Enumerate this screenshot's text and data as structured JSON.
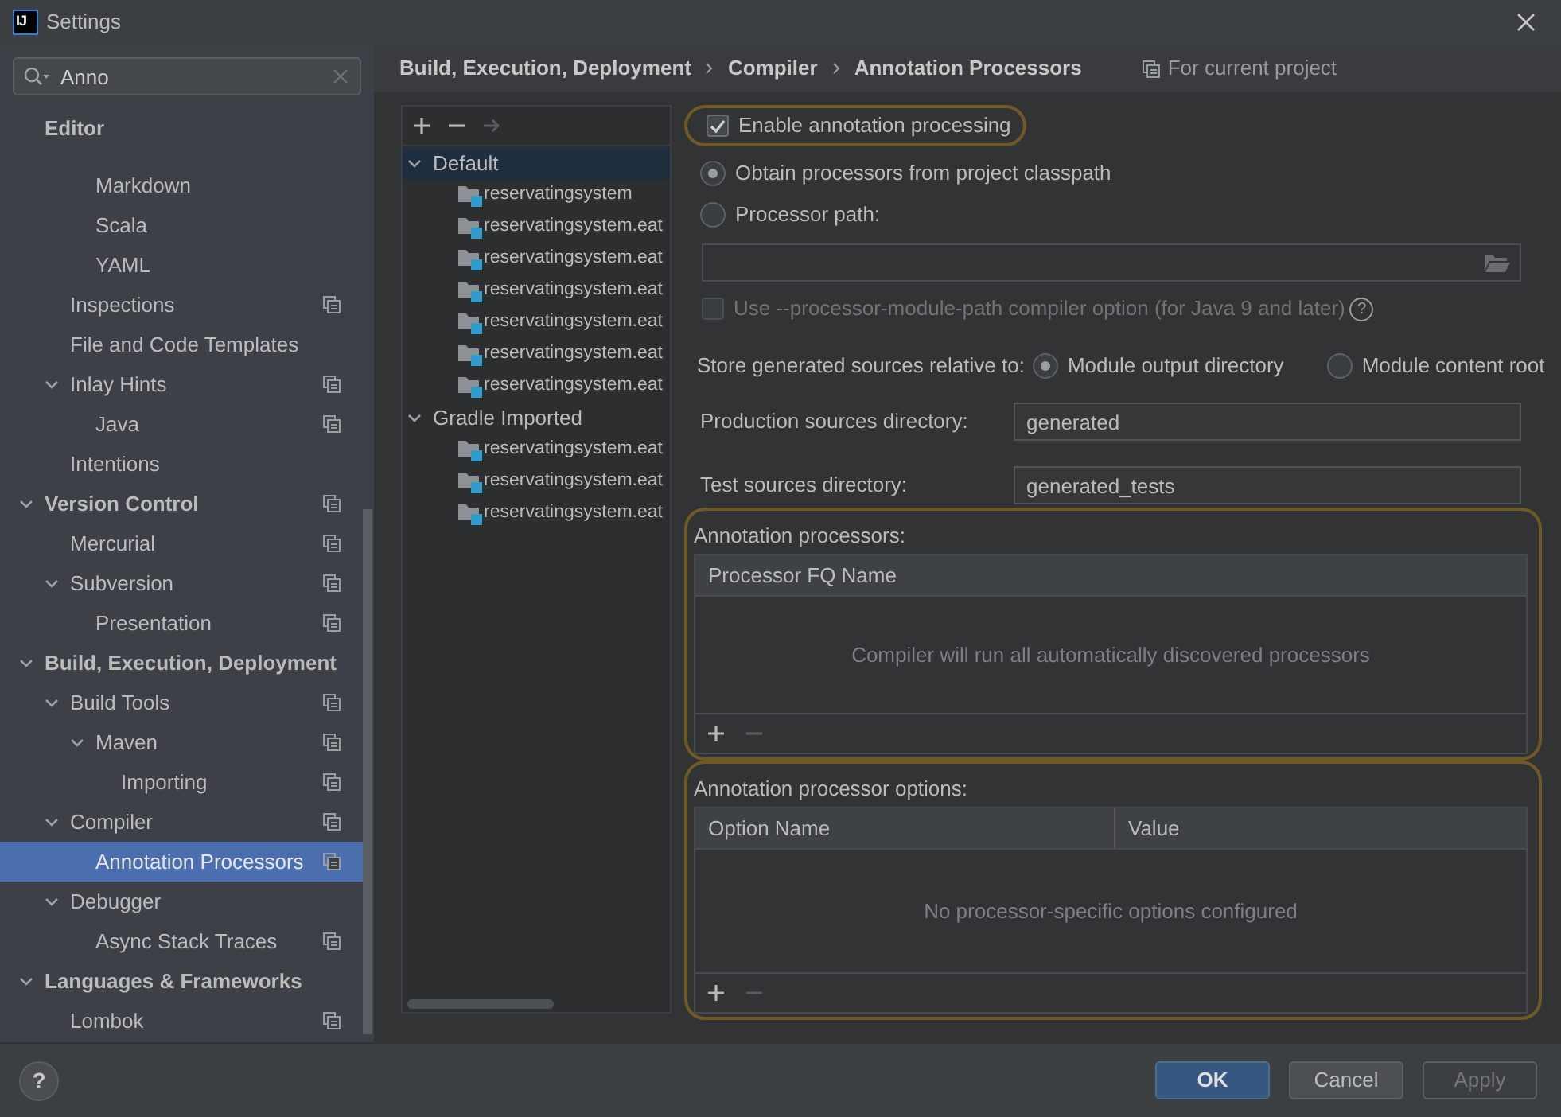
{
  "window": {
    "logo": "IJ",
    "title": "Settings"
  },
  "search": {
    "value": "Anno"
  },
  "sidebar": {
    "items": [
      {
        "label": "Editor",
        "sticky": true,
        "selected": false,
        "project_scope": false,
        "children": [
          {
            "children": [
              {
                "label": "Markdown",
                "selected": false,
                "project_scope": false
              },
              {
                "label": "Scala",
                "selected": false,
                "project_scope": false
              },
              {
                "label": "YAML",
                "selected": false,
                "project_scope": false
              }
            ]
          },
          {
            "label": "Inspections",
            "selected": false,
            "project_scope": true
          },
          {
            "label": "File and Code Templates",
            "selected": false,
            "project_scope": false
          },
          {
            "label": "Inlay Hints",
            "expanded": true,
            "selected": false,
            "project_scope": true,
            "children": [
              {
                "label": "Java",
                "selected": false,
                "project_scope": true
              }
            ]
          },
          {
            "label": "Intentions",
            "selected": false,
            "project_scope": false
          }
        ]
      },
      {
        "label": "Version Control",
        "expanded": true,
        "selected": false,
        "project_scope": true,
        "children": [
          {
            "label": "Mercurial",
            "selected": false,
            "project_scope": true
          },
          {
            "label": "Subversion",
            "expanded": true,
            "selected": false,
            "project_scope": true,
            "children": [
              {
                "label": "Presentation",
                "selected": false,
                "project_scope": true
              }
            ]
          }
        ]
      },
      {
        "label": "Build, Execution, Deployment",
        "expanded": true,
        "selected": false,
        "project_scope": false,
        "children": [
          {
            "label": "Build Tools",
            "expanded": true,
            "selected": false,
            "project_scope": true,
            "children": [
              {
                "label": "Maven",
                "expanded": true,
                "selected": false,
                "project_scope": true,
                "children": [
                  {
                    "label": "Importing",
                    "selected": false,
                    "project_scope": true
                  }
                ]
              }
            ]
          },
          {
            "label": "Compiler",
            "expanded": true,
            "selected": false,
            "project_scope": true,
            "children": [
              {
                "label": "Annotation Processors",
                "selected": true,
                "project_scope": true
              }
            ]
          },
          {
            "label": "Debugger",
            "expanded": true,
            "selected": false,
            "project_scope": false,
            "children": [
              {
                "label": "Async Stack Traces",
                "selected": false,
                "project_scope": true
              }
            ]
          }
        ]
      },
      {
        "label": "Languages & Frameworks",
        "expanded": true,
        "selected": false,
        "project_scope": false,
        "children": [
          {
            "label": "Lombok",
            "selected": false,
            "project_scope": true
          }
        ]
      }
    ]
  },
  "breadcrumb": {
    "items": [
      "Build, Execution, Deployment",
      "Compiler",
      "Annotation Processors"
    ],
    "scope": "For current project"
  },
  "profiles": {
    "toolbar": [
      {
        "kind": "add",
        "disabled": false
      },
      {
        "kind": "remove",
        "disabled": false
      },
      {
        "kind": "move",
        "disabled": true
      }
    ],
    "items": [
      {
        "label": "Default",
        "expanded": true,
        "selected": true,
        "children": [
          {
            "label": "reservatingsystem"
          },
          {
            "label": "reservatingsystem.eat"
          },
          {
            "label": "reservatingsystem.eat"
          },
          {
            "label": "reservatingsystem.eat"
          },
          {
            "label": "reservatingsystem.eat"
          },
          {
            "label": "reservatingsystem.eat"
          },
          {
            "label": "reservatingsystem.eat"
          }
        ]
      },
      {
        "label": "Gradle Imported",
        "expanded": true,
        "selected": false,
        "children": [
          {
            "label": "reservatingsystem.eat"
          },
          {
            "label": "reservatingsystem.eat"
          },
          {
            "label": "reservatingsystem.eat"
          }
        ]
      }
    ]
  },
  "form": {
    "enable": {
      "label": "Enable annotation processing",
      "checked": true,
      "highlighted": true
    },
    "source": [
      {
        "label": "Obtain processors from project classpath",
        "selected": true
      },
      {
        "label": "Processor path:",
        "selected": false
      }
    ],
    "processor_path": {
      "disabled": true
    },
    "module_path": {
      "label": "Use --processor-module-path compiler option (for Java 9 and later)",
      "checked": false,
      "disabled": true,
      "help": "?"
    },
    "store": {
      "label": "Store generated sources relative to:",
      "options": [
        {
          "label": "Module output directory",
          "selected": true
        },
        {
          "label": "Module content root",
          "selected": false
        }
      ]
    },
    "production": {
      "label": "Production sources directory:",
      "value": "generated"
    },
    "test": {
      "label": "Test sources directory:",
      "value": "generated_tests"
    },
    "sections": [
      {
        "title": "Annotation processors:",
        "highlighted": true,
        "columns": [
          "Processor FQ Name"
        ],
        "empty_text": "Compiler will run all automatically discovered processors",
        "toolbar": [
          {
            "kind": "add",
            "disabled": false
          },
          {
            "kind": "remove",
            "disabled": true
          }
        ]
      },
      {
        "title": "Annotation processor options:",
        "highlighted": true,
        "columns": [
          "Option Name",
          "Value"
        ],
        "empty_text": "No processor-specific options configured",
        "toolbar": [
          {
            "kind": "add",
            "disabled": false
          },
          {
            "kind": "remove",
            "disabled": true
          }
        ]
      }
    ]
  },
  "footer": {
    "help": "?",
    "buttons": [
      {
        "label": "OK",
        "kind": "primary",
        "disabled": false
      },
      {
        "label": "Cancel",
        "kind": "normal",
        "disabled": false
      },
      {
        "label": "Apply",
        "kind": "normal",
        "disabled": true
      }
    ]
  }
}
